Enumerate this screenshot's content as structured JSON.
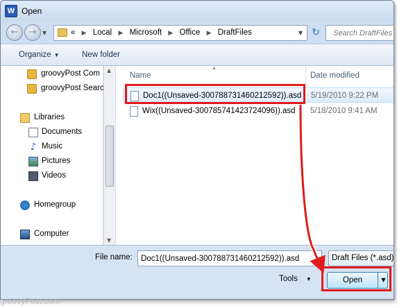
{
  "window": {
    "title": "Open",
    "app_icon_letter": "W"
  },
  "address_bar": {
    "overflow": "«",
    "crumbs": [
      "Local",
      "Microsoft",
      "Office",
      "DraftFiles"
    ],
    "search_placeholder": "Search DraftFiles"
  },
  "toolbar": {
    "organize": "Organize",
    "new_folder": "New folder"
  },
  "nav": {
    "favorites": [
      "groovyPost Com",
      "groovyPost Searc"
    ],
    "libraries": "Libraries",
    "library_items": [
      "Documents",
      "Music",
      "Pictures",
      "Videos"
    ],
    "homegroup": "Homegroup",
    "computer": "Computer"
  },
  "file_list": {
    "columns": {
      "name": "Name",
      "date": "Date modified"
    },
    "files": [
      {
        "name": "Doc1((Unsaved-300788731460212592)).asd",
        "date": "5/19/2010 9:22 PM"
      },
      {
        "name": "Wix((Unsaved-300785741423724096)).asd",
        "date": "5/18/2010 9:41 AM"
      }
    ]
  },
  "bottom": {
    "file_name_label": "File name:",
    "file_name_value": "Doc1((Unsaved-300788731460212592)).asd",
    "file_type": "Draft Files (*.asd)",
    "tools": "Tools",
    "open": "Open"
  },
  "watermark": "groovyPost.com",
  "colors": {
    "highlight": "#e01b1b",
    "accent": "#3c7fb1"
  }
}
